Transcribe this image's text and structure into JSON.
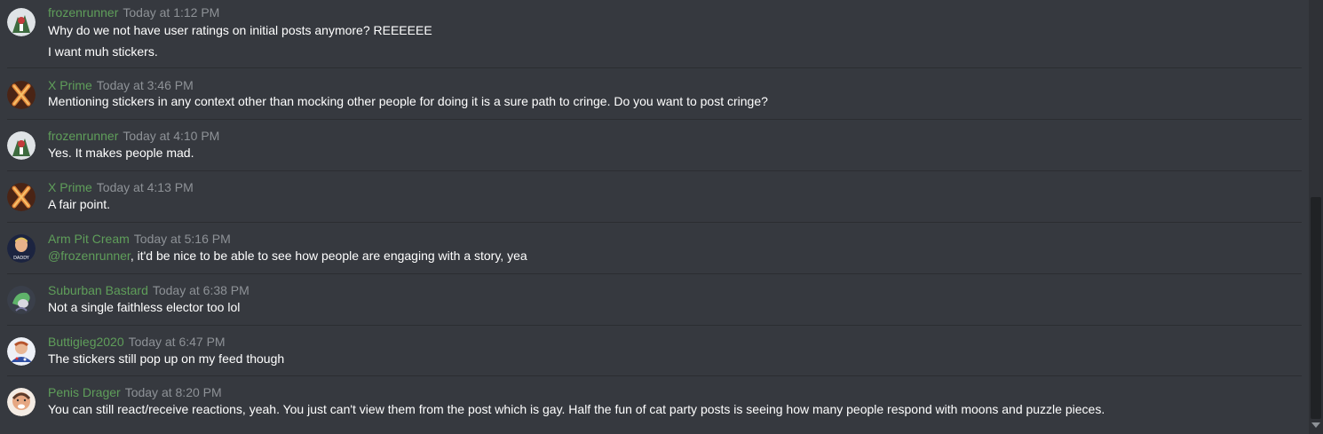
{
  "messages": [
    {
      "author": "frozenrunner",
      "time": "Today at 1:12 PM",
      "avatar": "frozenrunner-avatar",
      "lines": [
        "Why do we not have user ratings on initial posts anymore? REEEEEE",
        "I want muh stickers."
      ]
    },
    {
      "author": "X Prime",
      "time": "Today at 3:46 PM",
      "avatar": "x-prime-avatar",
      "lines": [
        "Mentioning stickers in any context other than mocking other people for doing it is a sure path to cringe. Do you want to post cringe?"
      ]
    },
    {
      "author": "frozenrunner",
      "time": "Today at 4:10 PM",
      "avatar": "frozenrunner-avatar",
      "lines": [
        "Yes. It makes people mad."
      ]
    },
    {
      "author": "X Prime",
      "time": "Today at 4:13 PM",
      "avatar": "x-prime-avatar",
      "lines": [
        "A fair point."
      ]
    },
    {
      "author": "Arm Pit Cream",
      "time": "Today at 5:16 PM",
      "avatar": "arm-pit-cream-avatar",
      "mention": "@frozenrunner",
      "lines": [
        ", it'd be nice to be able to see how people are engaging with a story, yea"
      ],
      "avatar_text": "DADDY"
    },
    {
      "author": "Suburban Bastard",
      "time": "Today at 6:38 PM",
      "avatar": "suburban-bastard-avatar",
      "lines": [
        "Not a single faithless elector too lol"
      ]
    },
    {
      "author": "Buttigieg2020",
      "time": "Today at 6:47 PM",
      "avatar": "buttigieg2020-avatar",
      "lines": [
        "The stickers still pop up on my feed though"
      ]
    },
    {
      "author": "Penis Drager",
      "time": "Today at 8:20 PM",
      "avatar": "penis-drager-avatar",
      "lines": [
        "You can still react/receive reactions, yeah. You just can't view them from the post which is gay. Half the fun of cat party posts is seeing how many people respond with moons and puzzle pieces."
      ]
    }
  ],
  "colors": {
    "background": "#36393f",
    "author": "#5f9e5a",
    "timestamp": "#8e9297",
    "text": "#ffffff"
  }
}
